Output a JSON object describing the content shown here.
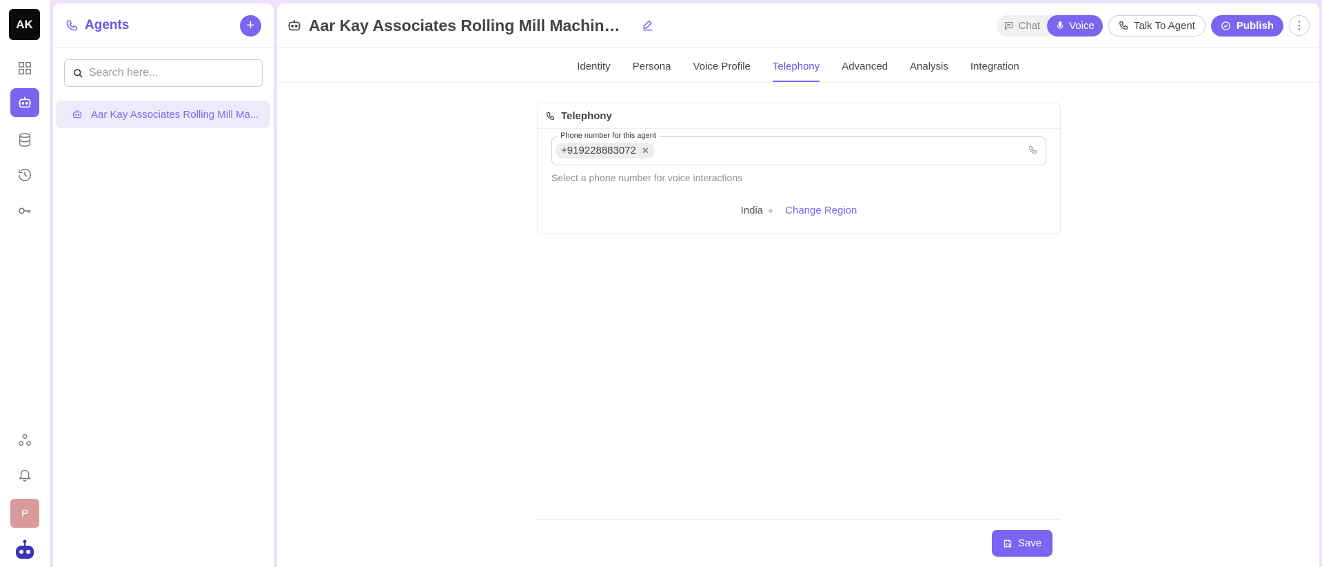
{
  "rail": {
    "logo_text": "AK",
    "icons": [
      "grid-icon",
      "robot-icon",
      "database-icon",
      "history-icon",
      "key-icon",
      "share-icon",
      "bell-icon"
    ],
    "active_icon": "robot-icon",
    "avatar_text": "P"
  },
  "panel": {
    "title": "Agents",
    "search_placeholder": "Search here...",
    "items": [
      {
        "label": "Aar Kay Associates Rolling Mill Ma..."
      }
    ]
  },
  "header": {
    "agent_title": "Aar Kay Associates Rolling Mill Machiner...",
    "mode_chat": "Chat",
    "mode_voice": "Voice",
    "active_mode": "Voice",
    "talk_label": "Talk To Agent",
    "publish_label": "Publish"
  },
  "tabs": [
    {
      "label": "Identity"
    },
    {
      "label": "Persona"
    },
    {
      "label": "Voice Profile"
    },
    {
      "label": "Telephony"
    },
    {
      "label": "Advanced"
    },
    {
      "label": "Analysis"
    },
    {
      "label": "Integration"
    }
  ],
  "active_tab": "Telephony",
  "telephony": {
    "section_title": "Telephony",
    "field_label": "Phone number for this agent",
    "selected_number": "+919228883072",
    "helper_text": "Select a phone number for voice interactions",
    "region": "India",
    "change_region_label": "Change Region"
  },
  "footer": {
    "save_label": "Save"
  },
  "colors": {
    "accent": "#7c64f0",
    "background": "#ece2fb"
  }
}
